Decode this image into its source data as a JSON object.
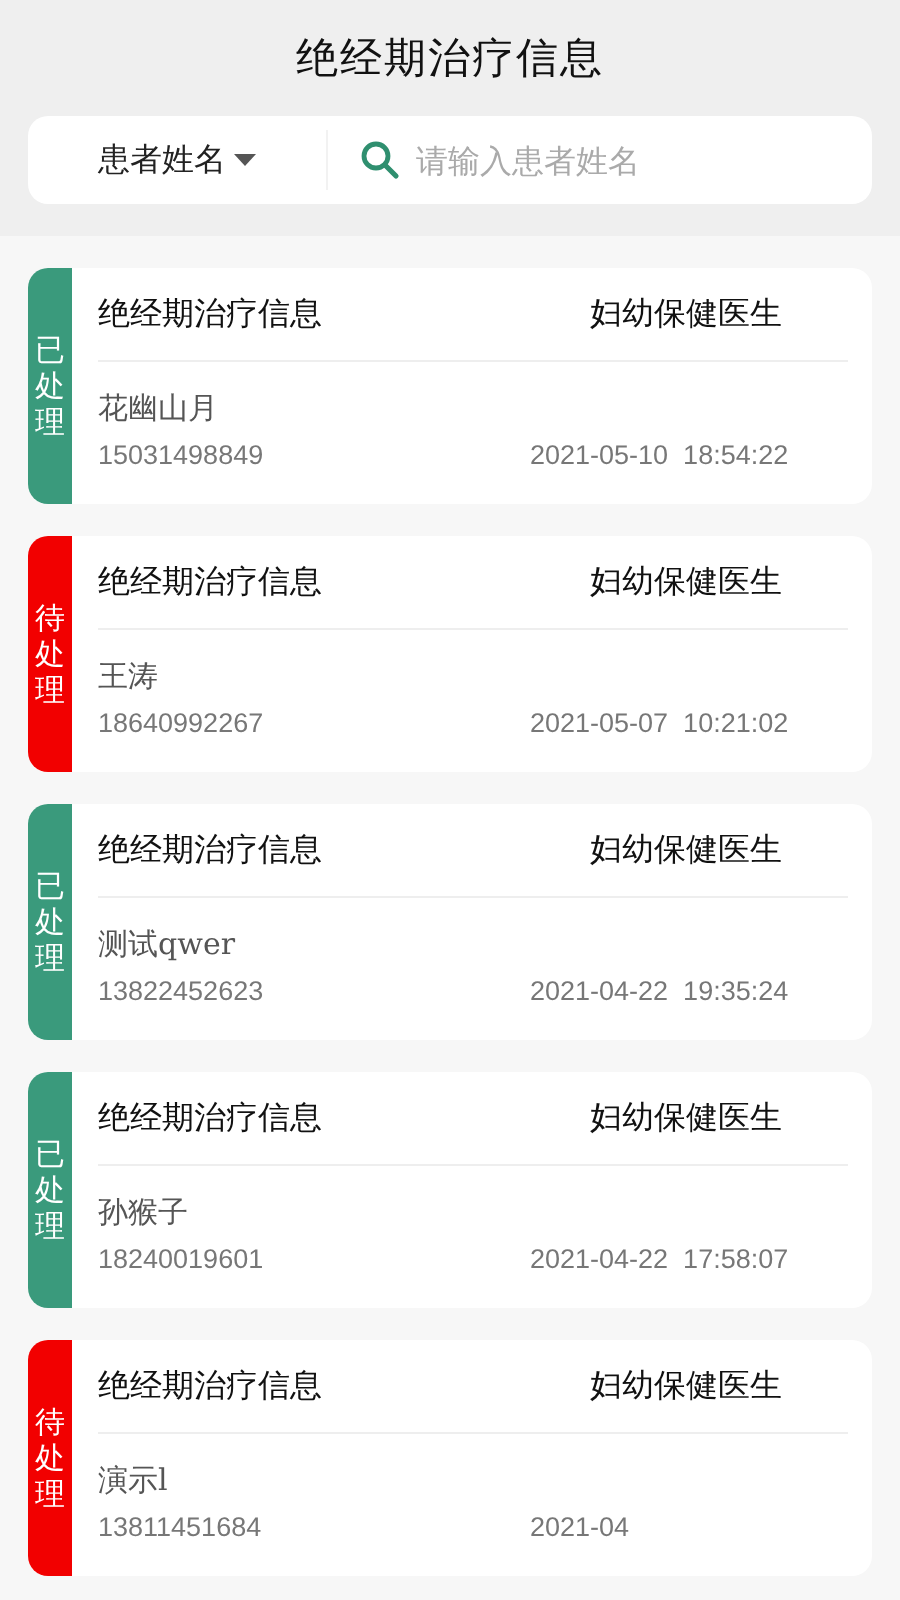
{
  "header": {
    "title": "绝经期治疗信息"
  },
  "search": {
    "filter_label": "患者姓名",
    "placeholder": "请输入患者姓名"
  },
  "records": [
    {
      "status": "已处理",
      "color": "#3a9a7c",
      "title": "绝经期治疗信息",
      "role": "妇幼保健医生",
      "name": "花幽山月",
      "phone": "15031498849",
      "date": "2021-05-10  18:54:22"
    },
    {
      "status": "待处理",
      "color": "#f20000",
      "title": "绝经期治疗信息",
      "role": "妇幼保健医生",
      "name": "王涛",
      "phone": "18640992267",
      "date": "2021-05-07  10:21:02"
    },
    {
      "status": "已处理",
      "color": "#3a9a7c",
      "title": "绝经期治疗信息",
      "role": "妇幼保健医生",
      "name": "测试qwer",
      "phone": "13822452623",
      "date": "2021-04-22  19:35:24"
    },
    {
      "status": "已处理",
      "color": "#3a9a7c",
      "title": "绝经期治疗信息",
      "role": "妇幼保健医生",
      "name": "孙猴子",
      "phone": "18240019601",
      "date": "2021-04-22  17:58:07"
    },
    {
      "status": "待处理",
      "color": "#f20000",
      "title": "绝经期治疗信息",
      "role": "妇幼保健医生",
      "name": "演示l",
      "phone": "13811451684",
      "date": "2021-04"
    }
  ]
}
